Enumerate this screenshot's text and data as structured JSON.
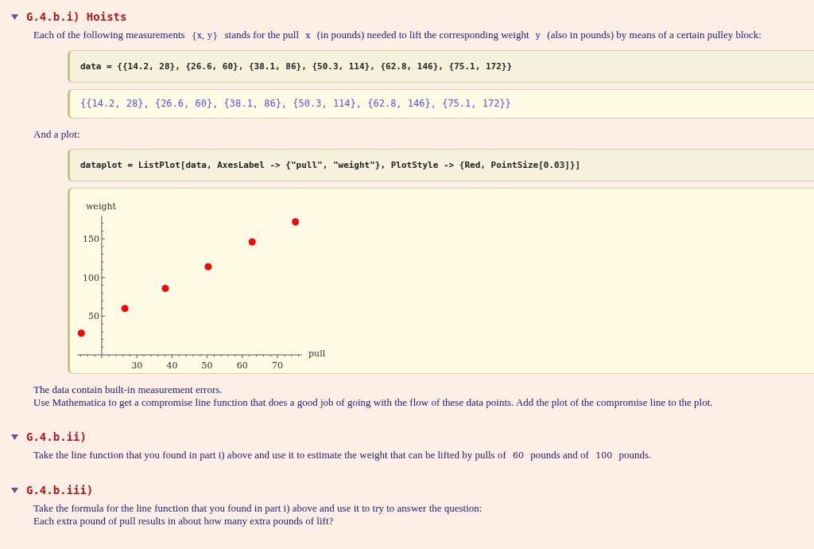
{
  "sections": [
    {
      "title": "G.4.b.i) Hoists",
      "expanded": true,
      "cells": [
        {
          "kind": "text",
          "lines": [
            [
              {
                "kind": "text",
                "text": "Each of the following measurements "
              },
              {
                "kind": "math",
                "text": "{x, y}"
              },
              {
                "kind": "text",
                "text": " stands for the pull "
              },
              {
                "kind": "math",
                "text": "x"
              },
              {
                "kind": "text",
                "text": " (in pounds) needed to lift the corresponding weight "
              },
              {
                "kind": "math",
                "text": "y"
              },
              {
                "kind": "text",
                "text": " (also in pounds) by means of a certain pulley block:"
              }
            ]
          ]
        },
        {
          "kind": "input",
          "code": "data = {{14.2, 28}, {26.6, 60}, {38.1, 86}, {50.3, 114}, {62.8, 146}, {75.1, 172}}"
        },
        {
          "kind": "output",
          "text": "{{14.2, 28}, {26.6, 60}, {38.1, 86}, {50.3, 114}, {62.8, 146}, {75.1, 172}}"
        },
        {
          "kind": "text",
          "lines": [
            [
              {
                "kind": "text",
                "text": "And a plot:"
              }
            ]
          ]
        },
        {
          "kind": "input",
          "code": "dataplot = ListPlot[data, AxesLabel -> {\"pull\", \"weight\"}, PlotStyle -> {Red, PointSize[0.03]}]"
        },
        {
          "kind": "plot",
          "chart_data": {
            "type": "scatter",
            "xlabel": "pull",
            "ylabel": "weight",
            "xlim": [
              13,
              77
            ],
            "ylim": [
              0,
              180
            ],
            "xticks": [
              30,
              40,
              50,
              60,
              70
            ],
            "yticks": [
              50,
              100,
              150
            ],
            "x": [
              14.2,
              26.6,
              38.1,
              50.3,
              62.8,
              75.1
            ],
            "series": [
              {
                "color": "#ff0000",
                "values": [
                  28,
                  60,
                  86,
                  114,
                  146,
                  172
                ]
              }
            ]
          }
        },
        {
          "kind": "text",
          "lines": [
            [
              {
                "kind": "text",
                "text": "The data contain built-in measurement errors."
              }
            ],
            [
              {
                "kind": "text",
                "text": "Use Mathematica to get a compromise line function that does a good job of going with the flow of these data points. Add the plot of the compromise line to the plot."
              }
            ]
          ]
        }
      ]
    },
    {
      "title": "G.4.b.ii)",
      "expanded": true,
      "cells": [
        {
          "kind": "text",
          "lines": [
            [
              {
                "kind": "text",
                "text": "Take the line function that you found in part i) above and use it to estimate the weight that can be lifted by pulls of "
              },
              {
                "kind": "math",
                "text": "60"
              },
              {
                "kind": "text",
                "text": " pounds and of "
              },
              {
                "kind": "math",
                "text": "100"
              },
              {
                "kind": "text",
                "text": " pounds."
              }
            ]
          ]
        }
      ]
    },
    {
      "title": "G.4.b.iii)",
      "expanded": true,
      "cells": [
        {
          "kind": "text",
          "lines": [
            [
              {
                "kind": "text",
                "text": "Take the formula for the line function that you found in part i) above and use it to try to answer the question:"
              }
            ],
            [
              {
                "kind": "text",
                "text": "Each extra pound of pull results in about how many extra pounds of lift?"
              }
            ]
          ]
        }
      ]
    }
  ]
}
